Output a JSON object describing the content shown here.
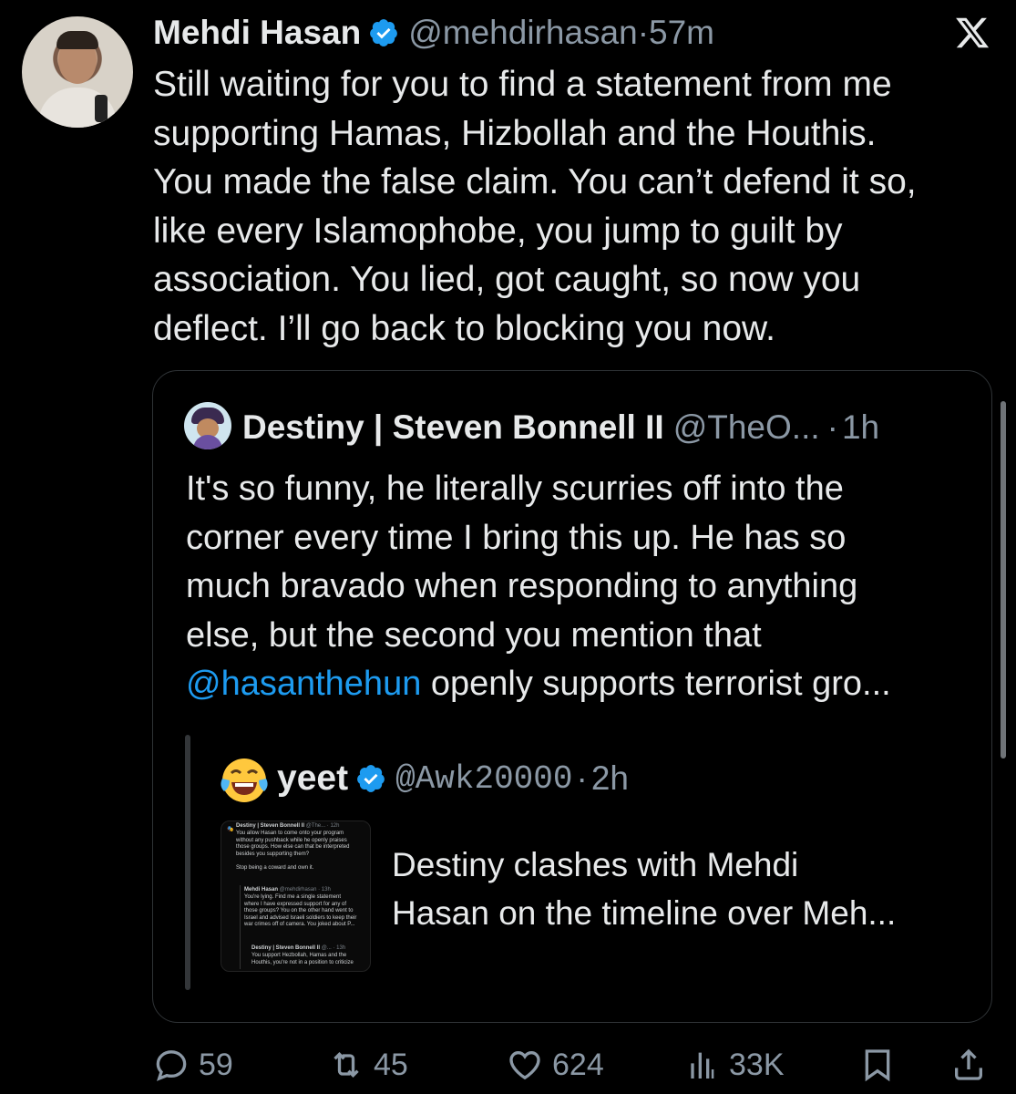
{
  "tweet": {
    "author_name": "Mehdi Hasan",
    "author_handle": "@mehdirhasan",
    "time": "57m",
    "verified": true,
    "avatar_icon": "profile-photo",
    "body_lines": [
      "Still waiting for you to find a statement from me",
      "supporting Hamas, Hizbollah and the Houthis.",
      "You made the false claim. You can’t defend it so,",
      "like every Islamophobe, you jump to guilt by",
      "association. You lied, got caught, so now you",
      "deflect. I’ll go back to blocking you now."
    ]
  },
  "quoted": {
    "author_name": "Destiny | Steven Bonnell II",
    "author_handle": "@TheO...",
    "time": "1h",
    "body_lines": [
      "It's so funny, he literally scurries off into the",
      "corner every time I bring this up. He has so",
      "much bravado when responding to anything",
      "else, but the second you mention that"
    ],
    "mention": "@hasanthehun",
    "last_line_rest": " openly supports terrorist gro..."
  },
  "nested": {
    "author_name": "yeet",
    "author_handle": "@Awk20000",
    "time": "2h",
    "emoji_icon": "tears-of-joy-emoji",
    "card_title_lines": [
      "Destiny clashes with Mehdi",
      "Hasan on the timeline over Meh..."
    ],
    "thumbnail": {
      "l1_name": "Destiny | Steven Bonnell II",
      "l1_meta": " @The... · 12h",
      "l1_text": "You allow Hasan to come onto your program\nwithout any pushback while he openly praises\nthose groups. How else can that be interpreted\nbesides you supporting them?\n\nStop being a coward and own it.",
      "l2_name": "Mehdi Hasan",
      "l2_meta": " @mehdirhasan · 13h",
      "l2_text": "You're lying. Find me a single statement\nwhere I have expressed support for any of\nthose groups? You on the other hand went to\nIsrael and advised Israeli soldiers to keep their\nwar crimes off of camera. You joked about P...",
      "l3_name": "Destiny | Steven Bonnell II",
      "l3_meta": " @... · 13h",
      "l3_text": "You support Hezbollah, Hamas and the\nHouthis, you're not in a position to criticize"
    }
  },
  "actions": {
    "replies": "59",
    "reposts": "45",
    "likes": "624",
    "views": "33K"
  },
  "colors": {
    "background": "#000000",
    "text": "#e7e9ea",
    "muted": "#8b98a5",
    "link": "#1d9bf0",
    "verified": "#1d9bf0"
  }
}
